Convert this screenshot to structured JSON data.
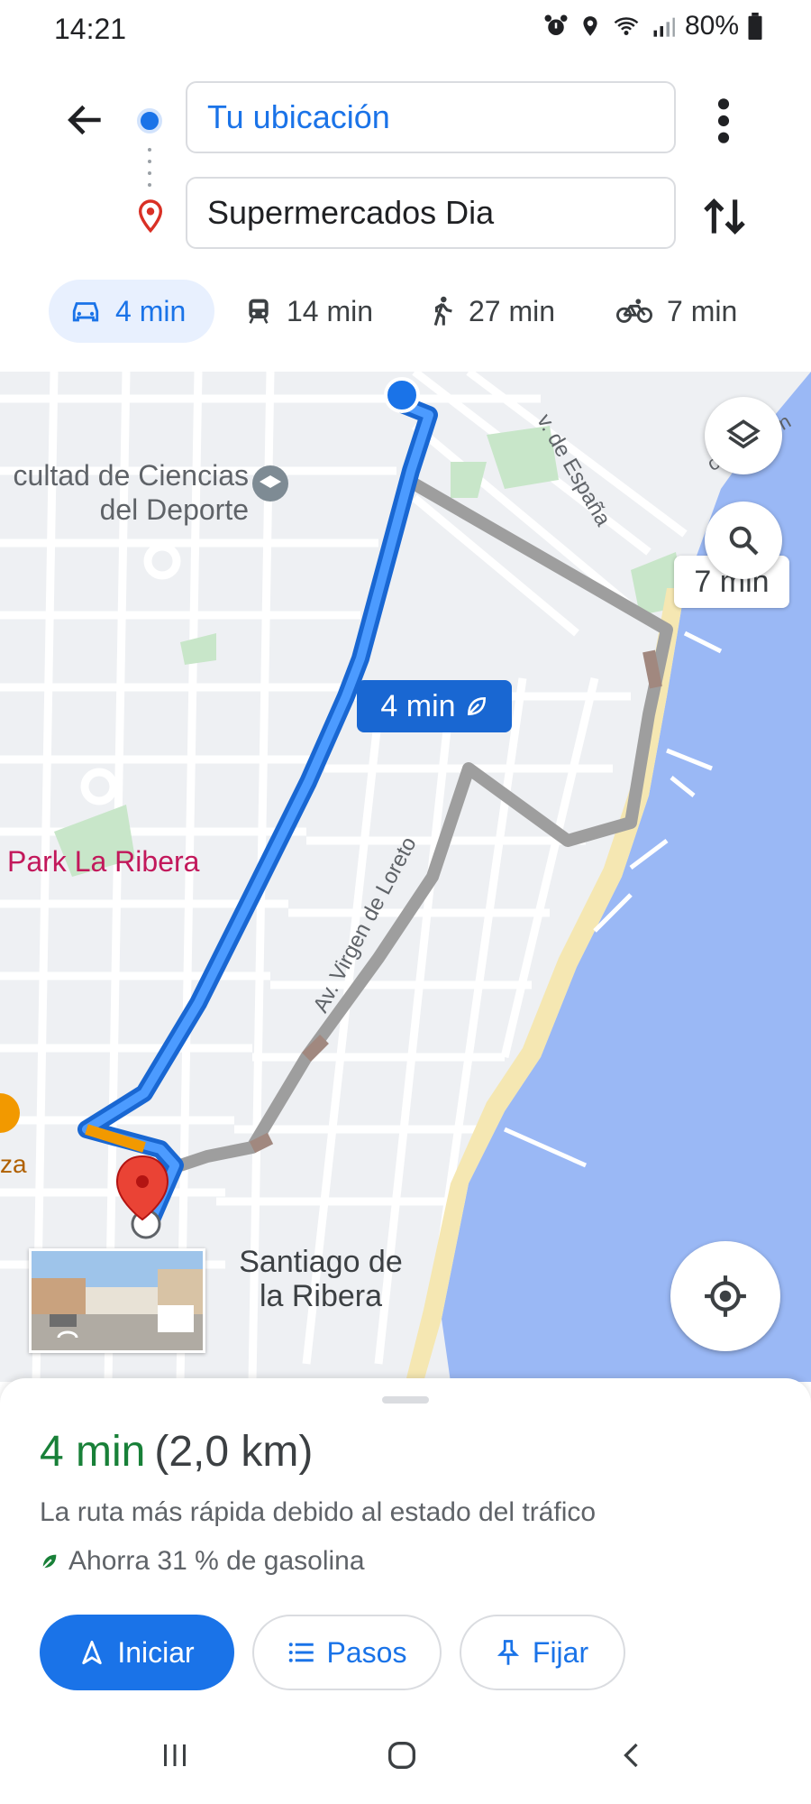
{
  "status_bar": {
    "time": "14:21",
    "battery": "80%",
    "icons": [
      "alarm-icon",
      "location-icon",
      "wifi-icon",
      "signal-icon",
      "battery-icon"
    ]
  },
  "directions": {
    "origin": "Tu ubicación",
    "destination": "Supermercados Dia",
    "modes": [
      {
        "name": "car",
        "label": "4 min",
        "selected": true
      },
      {
        "name": "transit",
        "label": "14 min",
        "selected": false
      },
      {
        "name": "walk",
        "label": "27 min",
        "selected": false
      },
      {
        "name": "bike",
        "label": "7 min",
        "selected": false
      }
    ]
  },
  "map": {
    "labels": {
      "facultad": "cultad de Ciencias\ndel Deporte",
      "park": "Park La Ribera",
      "santiago": "Santiago de\nla Ribera",
      "espana": "v. de España",
      "atalayon": "o Atalayón",
      "loreto": "Av. Virgen de Loreto",
      "za": "za"
    },
    "route_badge": "4 min",
    "alt_route_badge": "7 min",
    "colors": {
      "route": "#1a73e8",
      "alt_route": "#9e9e9e",
      "water": "#9ab8f5",
      "beach": "#f5e7b2"
    }
  },
  "sheet": {
    "duration": "4 min",
    "distance": "(2,0 km)",
    "reason": "La ruta más rápida debido al estado del tráfico",
    "savings": "Ahorra 31 % de gasolina",
    "buttons": {
      "start": "Iniciar",
      "steps": "Pasos",
      "pin": "Fijar"
    }
  }
}
